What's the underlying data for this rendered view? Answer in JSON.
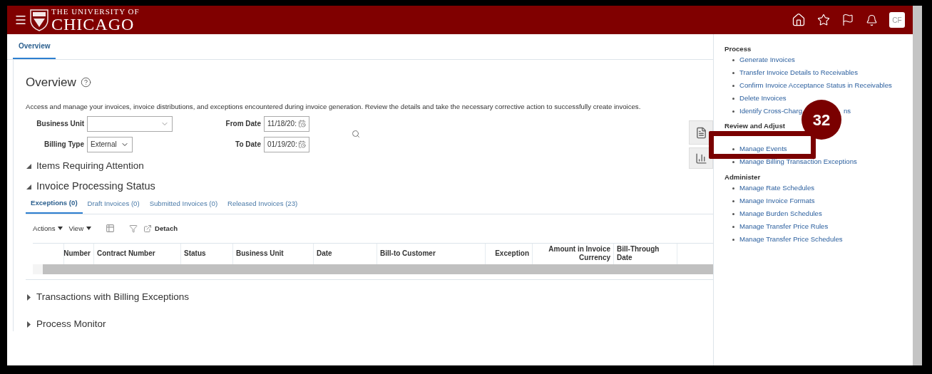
{
  "header": {
    "logo_line1": "THE UNIVERSITY OF",
    "logo_line2": "CHICAGO",
    "avatar": "CF"
  },
  "tabs": [
    {
      "label": "Overview",
      "selected": true
    }
  ],
  "overview": {
    "title": "Overview",
    "description": "Access and manage your invoices, invoice distributions, and exceptions encountered during invoice generation. Review the details and take the necessary corrective action to successfully create invoices.",
    "fields": [
      {
        "label": "Business Unit",
        "kind": "select"
      },
      {
        "label": "From Date",
        "kind": "date",
        "value": "11/18/20:"
      },
      {
        "label": "Billing Type",
        "kind": "select",
        "value": "External"
      },
      {
        "label": "To Date",
        "kind": "date",
        "value": "01/19/20:"
      }
    ]
  },
  "sections": [
    {
      "title": "Items Requiring Attention",
      "expanded": true
    },
    {
      "title": "Invoice Processing Status",
      "expanded": true,
      "status_tabs": [
        {
          "label": "Exceptions (0)",
          "selected": true
        },
        {
          "label": "Draft Invoices (0)",
          "selected": false
        },
        {
          "label": "Submitted Invoices (0)",
          "selected": false
        },
        {
          "label": "Released Invoices (23)",
          "selected": false
        }
      ],
      "toolbar": {
        "menus": [
          "Actions",
          "View"
        ],
        "detach": "Detach"
      },
      "columns": [
        "Number",
        "Contract Number",
        "Status",
        "Business Unit",
        "Date",
        "Bill-to Customer",
        "Exception",
        "Amount in Invoice Currency",
        "Bill-Through Date"
      ]
    },
    {
      "title": "Transactions with Billing Exceptions",
      "expanded": false
    },
    {
      "title": "Process Monitor",
      "expanded": false
    }
  ],
  "task_panel": [
    {
      "heading": "Process",
      "items": [
        {
          "label": "Generate Invoices",
          "highlighted": false
        },
        {
          "label": "Transfer Invoice Details to Receivables",
          "highlighted": false
        },
        {
          "label": "Confirm Invoice Acceptance Status in Receivables",
          "highlighted": false
        },
        {
          "label": "Delete Invoices",
          "highlighted": false
        },
        {
          "label": "Identify Cross-Charg",
          "tail": "ns",
          "highlighted": false
        }
      ]
    },
    {
      "heading": "Review and Adjust",
      "items": [
        {
          "label": "Manage Events",
          "highlighted": true,
          "callout": "32"
        },
        {
          "label": "Manage Billing Transaction Exceptions",
          "highlighted": false
        }
      ]
    },
    {
      "heading": "Administer",
      "items": [
        {
          "label": "Manage Rate Schedules",
          "highlighted": false
        },
        {
          "label": "Manage Invoice Formats",
          "highlighted": false
        },
        {
          "label": "Manage Burden Schedules",
          "highlighted": false
        },
        {
          "label": "Manage Transfer Price Rules",
          "highlighted": false
        },
        {
          "label": "Manage Transfer Price Schedules",
          "highlighted": false
        }
      ]
    }
  ]
}
